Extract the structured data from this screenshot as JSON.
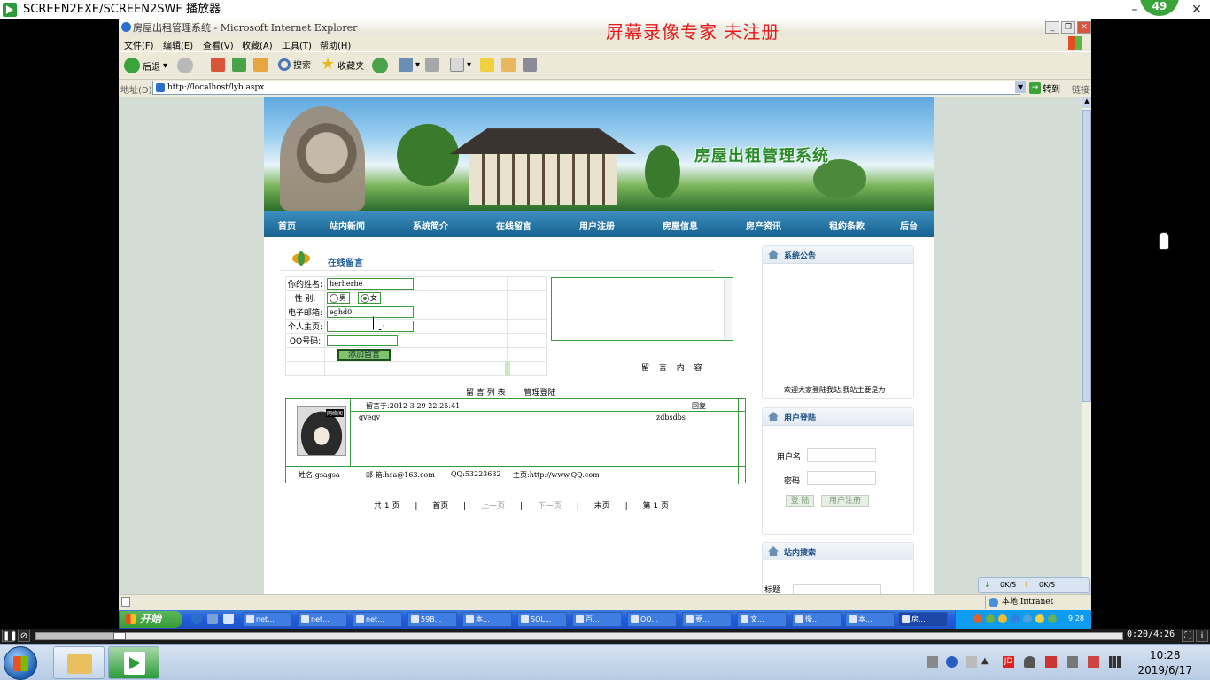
{
  "player": {
    "title": "SCREEN2EXE/SCREEN2SWF 播放器",
    "badge": "49",
    "time": "0:20/4:26",
    "progress_fraction": 0.077
  },
  "ie": {
    "title": "房屋出租管理系统 - Microsoft Internet Explorer",
    "watermark": "屏幕录像专家  未注册",
    "menu": [
      "文件(F)",
      "编辑(E)",
      "查看(V)",
      "收藏(A)",
      "工具(T)",
      "帮助(H)"
    ],
    "toolbar": {
      "back": "后退",
      "search": "搜索",
      "favorites": "收藏夹"
    },
    "address_label": "地址(D)",
    "url": "http://localhost/lyb.aspx",
    "go": "转到",
    "links": "链接",
    "status_zone": "本地 Intranet"
  },
  "site": {
    "name": "房屋出租管理系统",
    "nav": [
      "首页",
      "站内新闻",
      "系统简介",
      "在线留言",
      "用户注册",
      "房屋信息",
      "房产资讯",
      "租约条款",
      "后台"
    ]
  },
  "guestbook": {
    "heading": "在线留言",
    "name_label": "你的姓名:",
    "name_value": "herherhe",
    "gender_label": "性  别:",
    "gender_male": "男",
    "gender_female": "女",
    "email_label": "电子邮箱:",
    "email_value": "eghd0",
    "homepage_label": "个人主页:",
    "homepage_value": "",
    "qq_label": "QQ号码:",
    "qq_value": "",
    "submit": "添加留言",
    "content_label": "留 言 内 容",
    "list_link": "留 言 列 表",
    "admin_link": "管理登陆"
  },
  "entry": {
    "avatar_tag": "网络阅",
    "time": "留言于:2012-3-29 22:25:41",
    "reply_header": "回复",
    "content": "gvegv",
    "reply": "zdbsdbs",
    "name": "姓名:gsagsa",
    "email": "邮 箱:hsa@163.com",
    "qq": "QQ:53223632",
    "homepage": "主页:http://www.QQ.com"
  },
  "pager": {
    "total": "共 1 页",
    "sep": "|",
    "first": "首页",
    "prev": "上一页",
    "next": "下一页",
    "last": "末页",
    "current": "第 1 页"
  },
  "sidebar": {
    "announcement_title": "系统公告",
    "announcement_text": "欢迎大家登陆我站,我站主要是为",
    "login_title": "用户登陆",
    "username_label": "用户名",
    "password_label": "密码",
    "login_button": "登 陆",
    "register_button": "用户注册",
    "search_title": "站内搜索",
    "search_label": "标题"
  },
  "netmeter": {
    "down": "0K/S",
    "up": "0K/S"
  },
  "xp_taskbar": {
    "start": "开始",
    "tasks": [
      "net...",
      "net...",
      "net...",
      "59B...",
      "本...",
      "SQL...",
      "百...",
      "QQ...",
      "要...",
      "文...",
      "慢...",
      "本...",
      "房..."
    ],
    "clock": "9:28"
  },
  "w7_taskbar": {
    "time": "10:28",
    "date": "2019/6/17"
  }
}
